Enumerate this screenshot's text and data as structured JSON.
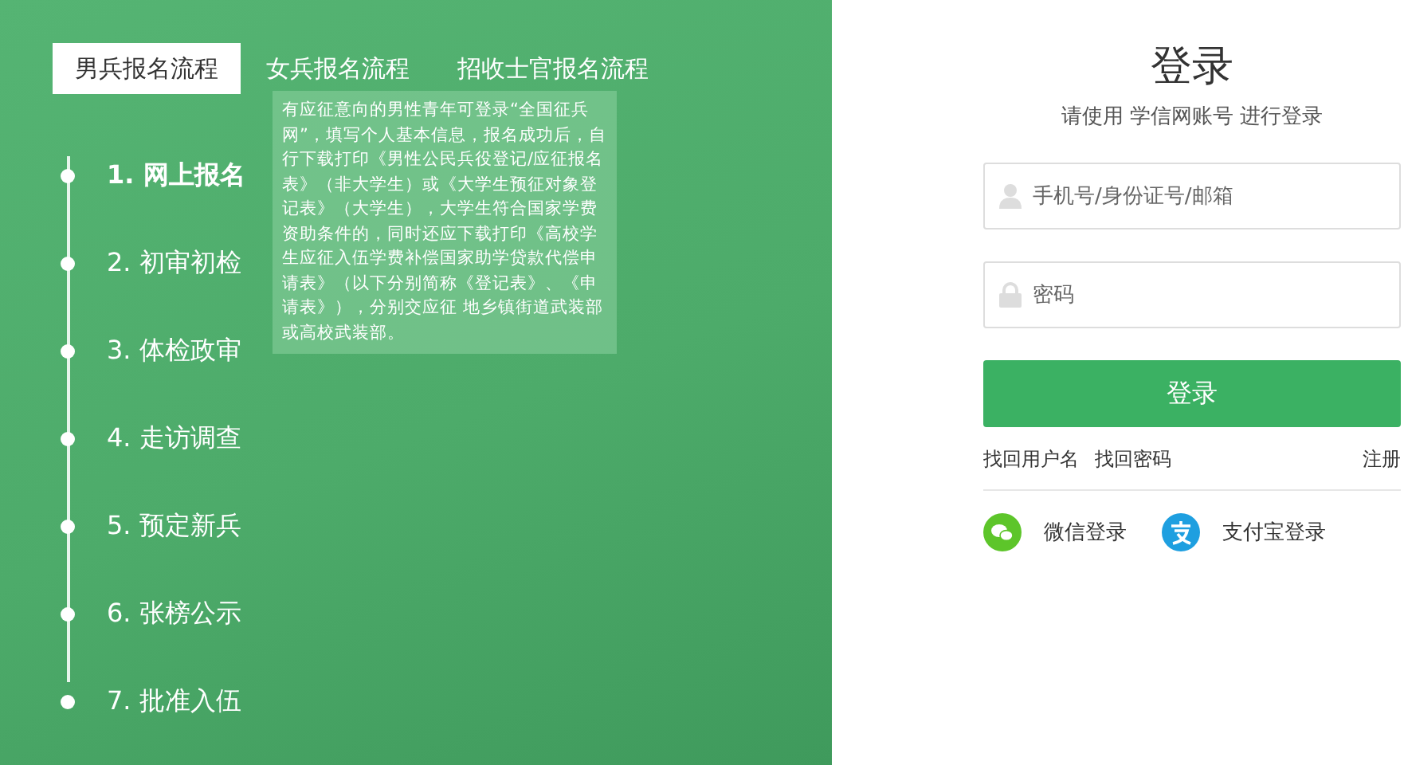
{
  "tabs": [
    {
      "label": "男兵报名流程",
      "selected": true
    },
    {
      "label": "女兵报名流程",
      "selected": false
    },
    {
      "label": "招收士官报名流程",
      "selected": false
    }
  ],
  "steps": [
    {
      "label": "1. 网上报名",
      "selected": true
    },
    {
      "label": "2. 初审初检",
      "selected": false
    },
    {
      "label": "3. 体检政审",
      "selected": false
    },
    {
      "label": "4. 走访调查",
      "selected": false
    },
    {
      "label": "5. 预定新兵",
      "selected": false
    },
    {
      "label": "6. 张榜公示",
      "selected": false
    },
    {
      "label": "7. 批准入伍",
      "selected": false
    }
  ],
  "step_tooltip": "有应征意向的男性青年可登录“全国征兵网”，填写个人基本信息，报名成功后，自行下载打印《男性公民兵役登记/应征报名表》（非大学生）或《大学生预征对象登记表》（大学生），大学生符合国家学费资助条件的，同时还应下载打印《高校学生应征入伍学费补偿国家助学贷款代偿申请表》（以下分别简称《登记表》、《申请表》），分别交应征 地乡镇街道武装部或高校武装部。",
  "login": {
    "title": "登录",
    "subtitle": "请使用 学信网账号 进行登录",
    "fields": [
      {
        "kind": "user",
        "placeholder": "手机号/身份证号/邮箱"
      },
      {
        "kind": "password",
        "placeholder": "密码"
      }
    ],
    "submit": "登录",
    "links": [
      "找回用户名",
      "找回密码"
    ],
    "register": "注册",
    "social": [
      {
        "kind": "wechat",
        "label": "微信登录"
      },
      {
        "kind": "alipay",
        "label": "支付宝登录"
      }
    ]
  }
}
